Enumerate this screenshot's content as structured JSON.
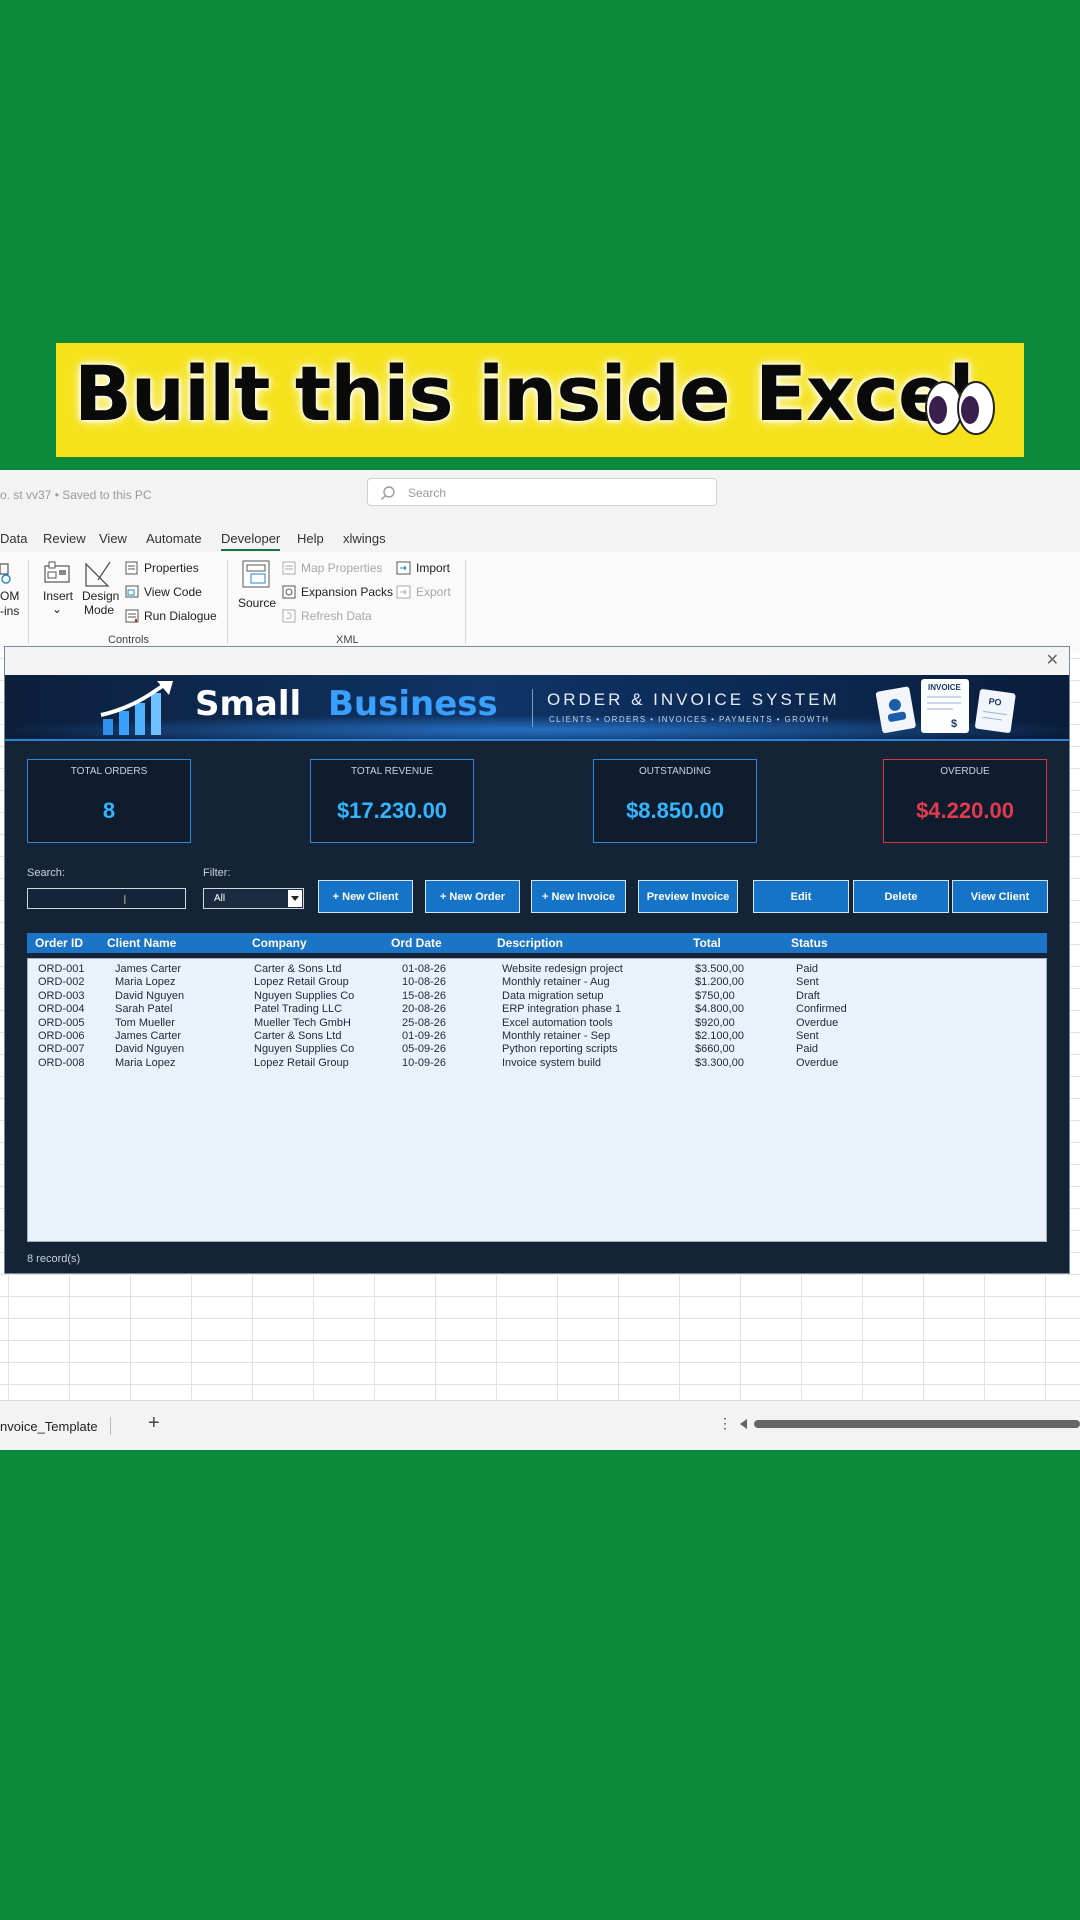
{
  "caption": {
    "text": "Built this inside Excel"
  },
  "excel": {
    "doc_title": "o. st vv37  •  Saved to this PC",
    "search_placeholder": "Search",
    "menu": [
      "Data",
      "Review",
      "View",
      "Automate",
      "Developer",
      "Help",
      "xlwings"
    ],
    "active_menu": "Developer",
    "ribbon": {
      "addins_partial": [
        "OM",
        "-ins"
      ],
      "insert": "Insert",
      "design_mode": [
        "Design",
        "Mode"
      ],
      "properties": "Properties",
      "view_code": "View Code",
      "run_dialogue": "Run Dialogue",
      "controls_group": "Controls",
      "source": "Source",
      "map_properties": "Map Properties",
      "expansion_packs": "Expansion Packs",
      "refresh_data": "Refresh Data",
      "import": "Import",
      "export": "Export",
      "xml_group": "XML"
    },
    "sheet_tab": "nvoice_Template",
    "add_sheet": "+"
  },
  "form": {
    "banner": {
      "brand_1": "Small",
      "brand_2": "Business",
      "system_title": "ORDER & INVOICE SYSTEM",
      "tagline": "CLIENTS • ORDERS • INVOICES • PAYMENTS • GROWTH",
      "invoice_doc": "INVOICE",
      "po_doc": "PO"
    },
    "kpis": [
      {
        "label": "TOTAL ORDERS",
        "value": "8"
      },
      {
        "label": "TOTAL REVENUE",
        "value": "$17.230.00"
      },
      {
        "label": "OUTSTANDING",
        "value": "$8.850.00"
      },
      {
        "label": "OVERDUE",
        "value": "$4.220.00"
      }
    ],
    "search_label": "Search:",
    "filter_label": "Filter:",
    "filter_value": "All",
    "buttons": [
      "+ New Client",
      "+ New Order",
      "+ New Invoice",
      "Preview Invoice",
      "Edit",
      "Delete",
      "View Client"
    ],
    "columns": [
      "Order ID",
      "Client Name",
      "Company",
      "Ord Date",
      "Description",
      "Total",
      "Status"
    ],
    "rows": [
      [
        "ORD-001",
        "James Carter",
        "Carter & Sons Ltd",
        "01-08-26",
        "Website redesign project",
        "$3.500,00",
        "Paid"
      ],
      [
        "ORD-002",
        "Maria Lopez",
        "Lopez Retail Group",
        "10-08-26",
        "Monthly retainer - Aug",
        "$1.200,00",
        "Sent"
      ],
      [
        "ORD-003",
        "David Nguyen",
        "Nguyen Supplies Co",
        "15-08-26",
        "Data migration setup",
        "$750,00",
        "Draft"
      ],
      [
        "ORD-004",
        "Sarah Patel",
        "Patel Trading LLC",
        "20-08-26",
        "ERP integration phase 1",
        "$4.800,00",
        "Confirmed"
      ],
      [
        "ORD-005",
        "Tom Mueller",
        "Mueller Tech GmbH",
        "25-08-26",
        "Excel automation tools",
        "$920,00",
        "Overdue"
      ],
      [
        "ORD-006",
        "James Carter",
        "Carter & Sons Ltd",
        "01-09-26",
        "Monthly retainer - Sep",
        "$2.100,00",
        "Sent"
      ],
      [
        "ORD-007",
        "David Nguyen",
        "Nguyen Supplies Co",
        "05-09-26",
        "Python reporting scripts",
        "$660,00",
        "Paid"
      ],
      [
        "ORD-008",
        "Maria Lopez",
        "Lopez Retail Group",
        "10-09-26",
        "Invoice system build",
        "$3.300,00",
        "Overdue"
      ]
    ],
    "record_count": "8 record(s)"
  },
  "colors": {
    "background_green": "#0b8a3c",
    "caption_yellow": "#f5e21a",
    "form_navy": "#142336",
    "accent_blue": "#1674c8",
    "kpi_blue": "#34b5ff",
    "overdue_red": "#e23b4f"
  }
}
